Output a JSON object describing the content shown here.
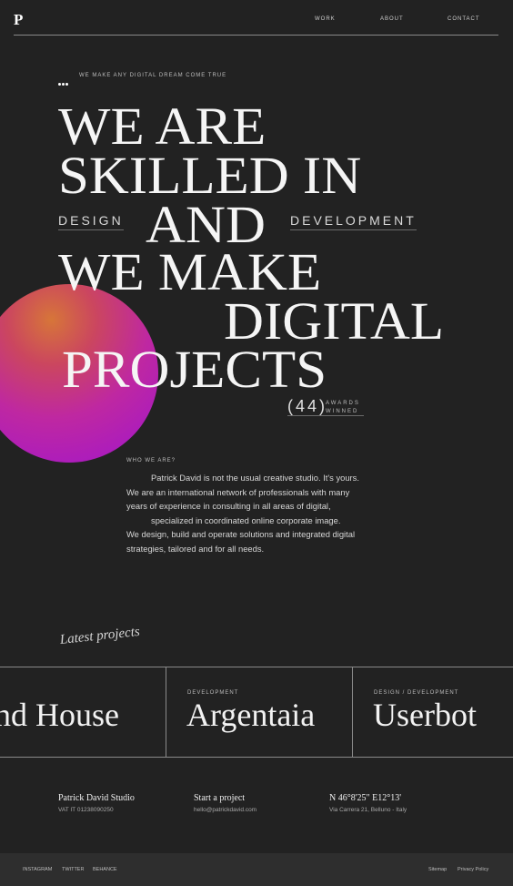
{
  "header": {
    "logo": "P",
    "nav": [
      "WORK",
      "ABOUT",
      "CONTACT"
    ]
  },
  "tagline": "WE MAKE ANY DIGITAL DREAM COME TRUE",
  "hero": {
    "lines": [
      "WE ARE",
      "SKILLED IN",
      "AND",
      "WE MAKE",
      "DIGITAL",
      "PROJECTS"
    ],
    "side_left": "DESIGN",
    "side_right": "DEVELOPMENT"
  },
  "awards": {
    "count": "(44)",
    "label_line1": "AWARDS",
    "label_line2": "WINNED"
  },
  "about": {
    "heading": "WHO WE ARE?",
    "lines": [
      "Patrick David is not the usual creative studio. It's yours.",
      "We are an international network of professionals with many",
      "years of experience in consulting in all areas of digital,",
      "specialized in coordinated online corporate image.",
      "We design, build and operate solutions and integrated digital",
      "strategies, tailored and for all needs."
    ]
  },
  "latest_label": "Latest projects",
  "projects": [
    {
      "category": "",
      "title": "nd House"
    },
    {
      "category": "DEVELOPMENT",
      "title": "Argentaia"
    },
    {
      "category": "DESIGN / DEVELOPMENT",
      "title": "Userbot"
    }
  ],
  "footer": {
    "studio_name": "Patrick David Studio",
    "vat": "VAT IT 01238090250",
    "start_heading": "Start a project",
    "email": "hello@patrickdavid.com",
    "coords": "N 46°8'25\" E12°13'",
    "address": "Via Carrera 21, Belluno - Italy"
  },
  "bottom": {
    "social": [
      "INSTAGRAM",
      "TWITTER",
      "BEHANCE"
    ],
    "sitemap": "Sitemap",
    "privacy": "Privacy Policy"
  },
  "colors": {
    "background": "#222222",
    "bottom_bar": "#2e2e2e",
    "orb_top": "#e07a3a",
    "orb_bottom": "#b51dc2"
  }
}
